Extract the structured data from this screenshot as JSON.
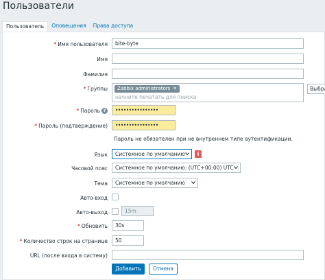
{
  "header": {
    "title": "Пользователи"
  },
  "tabs": [
    {
      "label": "Пользователь"
    },
    {
      "label": "Оповещения"
    },
    {
      "label": "Права доступа"
    }
  ],
  "form": {
    "username": {
      "label": "Имя пользователя",
      "value": "bite-byte"
    },
    "name": {
      "label": "Имя",
      "value": ""
    },
    "surname": {
      "label": "Фамилия",
      "value": ""
    },
    "groups": {
      "label": "Группы",
      "tag": "Zabbix administrators",
      "tag_remove": "✕",
      "placeholder": "начните печатать для поиска",
      "select_button": "Выбрать"
    },
    "password": {
      "label": "Пароль",
      "value": "••••••••••••••••"
    },
    "password_confirm": {
      "label": "Пароль (подтверждение)",
      "value": "••••••••••••••••"
    },
    "password_hint": "Пароль не обязателен при не внутреннем типе аутентификации.",
    "language": {
      "label": "Язык",
      "value": "Системное по умолчанию"
    },
    "timezone": {
      "label": "Часовой пояс",
      "value": "Системное по умолчанию: (UTC+00:00) UTC"
    },
    "theme": {
      "label": "Тема",
      "value": "Системное по умолчанию"
    },
    "autologin": {
      "label": "Авто-вход"
    },
    "autologout": {
      "label": "Авто-выход",
      "value": "15m"
    },
    "refresh": {
      "label": "Обновить",
      "value": "30s"
    },
    "rows_per_page": {
      "label": "Количество строк на странице",
      "value": "50"
    },
    "url": {
      "label": "URL (после входа в систему)",
      "value": ""
    }
  },
  "buttons": {
    "add": "Добавить",
    "cancel": "Отмена"
  },
  "icons": {
    "help": "?",
    "info": "i"
  },
  "colors": {
    "accent": "#0275b8",
    "required": "#d40000",
    "password_bg": "#fbeb9d",
    "warning": "#e45959"
  }
}
